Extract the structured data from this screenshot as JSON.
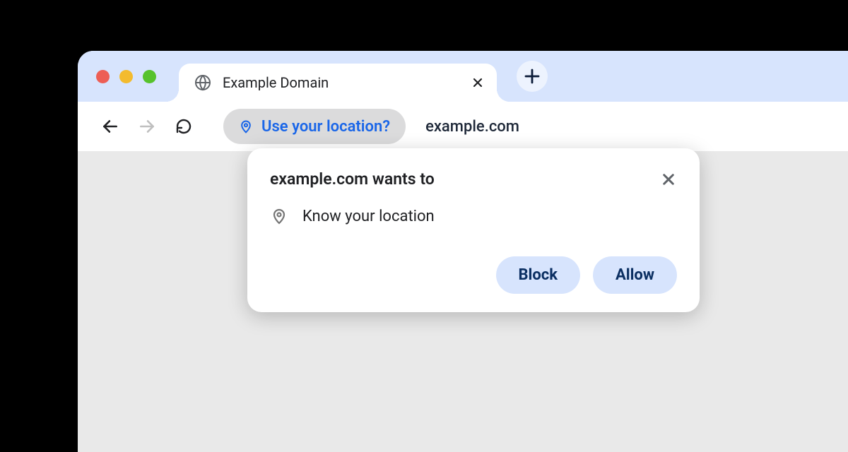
{
  "window": {
    "traffic_lights": {
      "red": "#ed5e55",
      "yellow": "#f3bb2e",
      "green": "#56c22c"
    }
  },
  "tab": {
    "title": "Example Domain",
    "favicon": "globe-icon"
  },
  "toolbar": {
    "back_enabled": true,
    "forward_enabled": false,
    "permission_chip": {
      "icon": "location-pin-icon",
      "label": "Use your location?"
    },
    "url": "example.com"
  },
  "permission_dialog": {
    "title": "example.com wants to",
    "items": [
      {
        "icon": "location-pin-icon",
        "label": "Know your location"
      }
    ],
    "buttons": {
      "block": "Block",
      "allow": "Allow"
    }
  },
  "colors": {
    "tab_strip_bg": "#d7e4fd",
    "chip_accent": "#1a66e8",
    "btn_bg": "#d7e4fd",
    "btn_text": "#0b2f62"
  }
}
